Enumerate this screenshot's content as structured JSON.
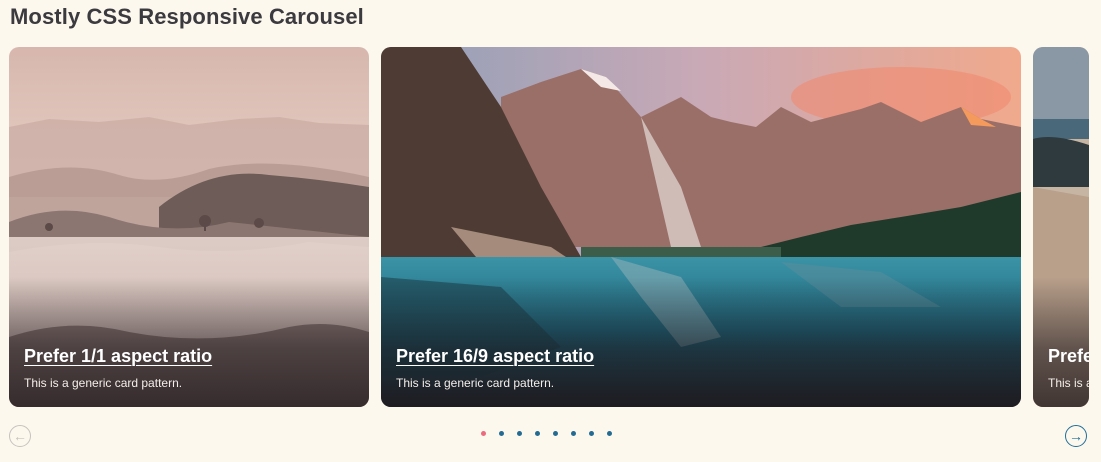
{
  "page": {
    "title": "Mostly CSS Responsive Carousel"
  },
  "cards": [
    {
      "title": "Prefer 1/1 aspect ratio",
      "description": "This is a generic card pattern."
    },
    {
      "title": "Prefer 16/9 aspect ratio",
      "description": "This is a generic card pattern."
    },
    {
      "title": "Prefe",
      "description": "This is a"
    }
  ],
  "nav": {
    "prev_icon": "arrow-left-icon",
    "next_icon": "arrow-right-icon"
  },
  "pagination": {
    "count": 8,
    "active_index": 0,
    "active_color": "#ec6a7e",
    "color": "#246b93"
  },
  "colors": {
    "background": "#fdf8ee",
    "accent": "#1f6f9a"
  }
}
